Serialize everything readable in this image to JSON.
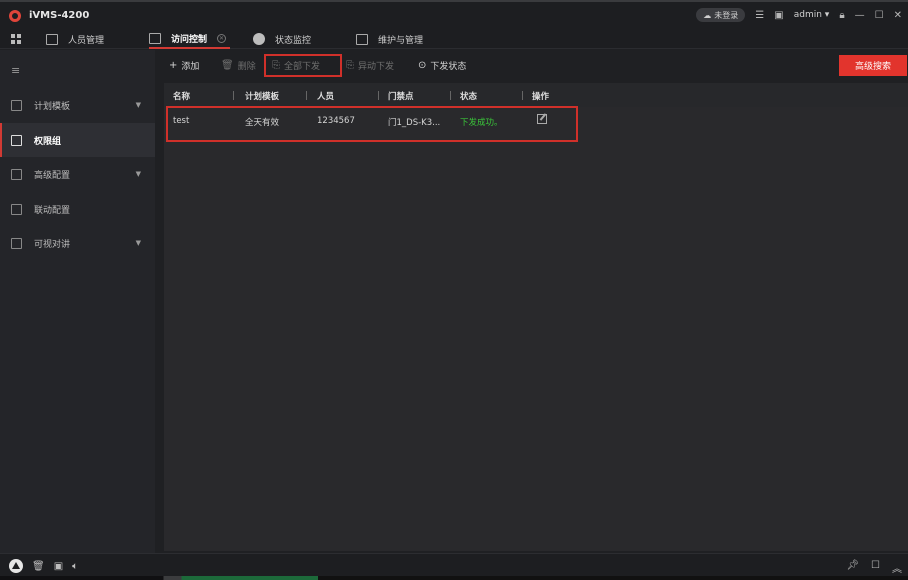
{
  "app": {
    "title": "iVMS-4200"
  },
  "titlebar": {
    "login_status": "未登录",
    "user": "admin"
  },
  "tabs": [
    {
      "label": "人员管理"
    },
    {
      "label": "访问控制"
    },
    {
      "label": "状态监控"
    },
    {
      "label": "维护与管理"
    }
  ],
  "sidebar": {
    "items": [
      {
        "label": "计划模板"
      },
      {
        "label": "权限组"
      },
      {
        "label": "高级配置"
      },
      {
        "label": "联动配置"
      },
      {
        "label": "可视对讲"
      }
    ]
  },
  "toolbar": {
    "add": "添加",
    "delete": "删除",
    "deploy_all": "全部下发",
    "async_deploy": "异动下发",
    "deploy_status": "下发状态",
    "advanced_search": "高级搜索"
  },
  "table": {
    "headers": [
      "名称",
      "计划模板",
      "人员",
      "门禁点",
      "状态",
      "操作"
    ],
    "rows": [
      {
        "name": "test",
        "template": "全天有效",
        "persons": "1234567",
        "door": "门1_DS-K3...",
        "status": "下发成功。"
      }
    ]
  },
  "colors": {
    "accent": "#e2342d",
    "success": "#3ac63a",
    "highlight_box": "#d0302a"
  }
}
